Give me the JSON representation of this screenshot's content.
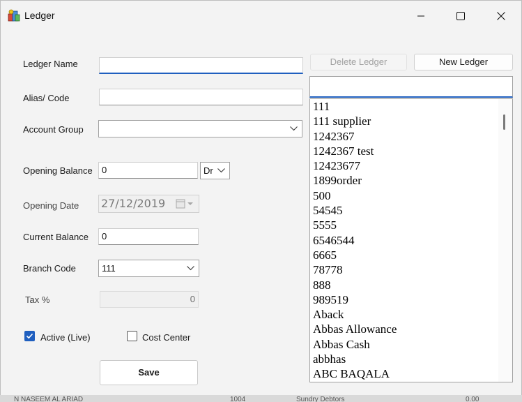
{
  "window": {
    "title": "Ledger",
    "icon": "ledger-app-icon",
    "controls": [
      "minimize-icon",
      "maximize-icon",
      "close-icon"
    ]
  },
  "form": {
    "ledger_name_label": "Ledger Name",
    "ledger_name_value": "",
    "alias_label": "Alias/ Code",
    "alias_value": "",
    "account_group_label": "Account Group",
    "account_group_value": "",
    "opening_balance_label": "Opening Balance",
    "opening_balance_value": "0",
    "dr_cr_value": "Dr",
    "opening_date_label": "Opening Date",
    "opening_date_value": "27/12/2019",
    "current_balance_label": "Current Balance",
    "current_balance_value": "0",
    "branch_code_label": "Branch Code",
    "branch_code_value": "111",
    "tax_label": "Tax %",
    "tax_value": "0",
    "active_label": "Active (Live)",
    "active_checked": true,
    "cost_center_label": "Cost Center",
    "cost_center_checked": false,
    "save_label": "Save"
  },
  "right_panel": {
    "delete_label": "Delete Ledger",
    "new_label": "New Ledger",
    "search_value": "",
    "ledger_list": [
      "111",
      "111 supplier",
      "1242367",
      "1242367 test",
      "12423677",
      "1899order",
      "500",
      "54545",
      "5555",
      "6546544",
      "6665",
      "78778",
      "888",
      "989519",
      "Aback",
      "Abbas Allowance",
      "Abbas Cash",
      "abbhas",
      "ABC BAQALA"
    ]
  },
  "background_strip": {
    "text_1": "N NASEEM AL ARIAD",
    "text_2": "1004",
    "text_3": "Sundry Debtors",
    "text_4": "0.00"
  },
  "colors": {
    "accent": "#1f5fbf",
    "window_bg": "#f3f3f3"
  }
}
